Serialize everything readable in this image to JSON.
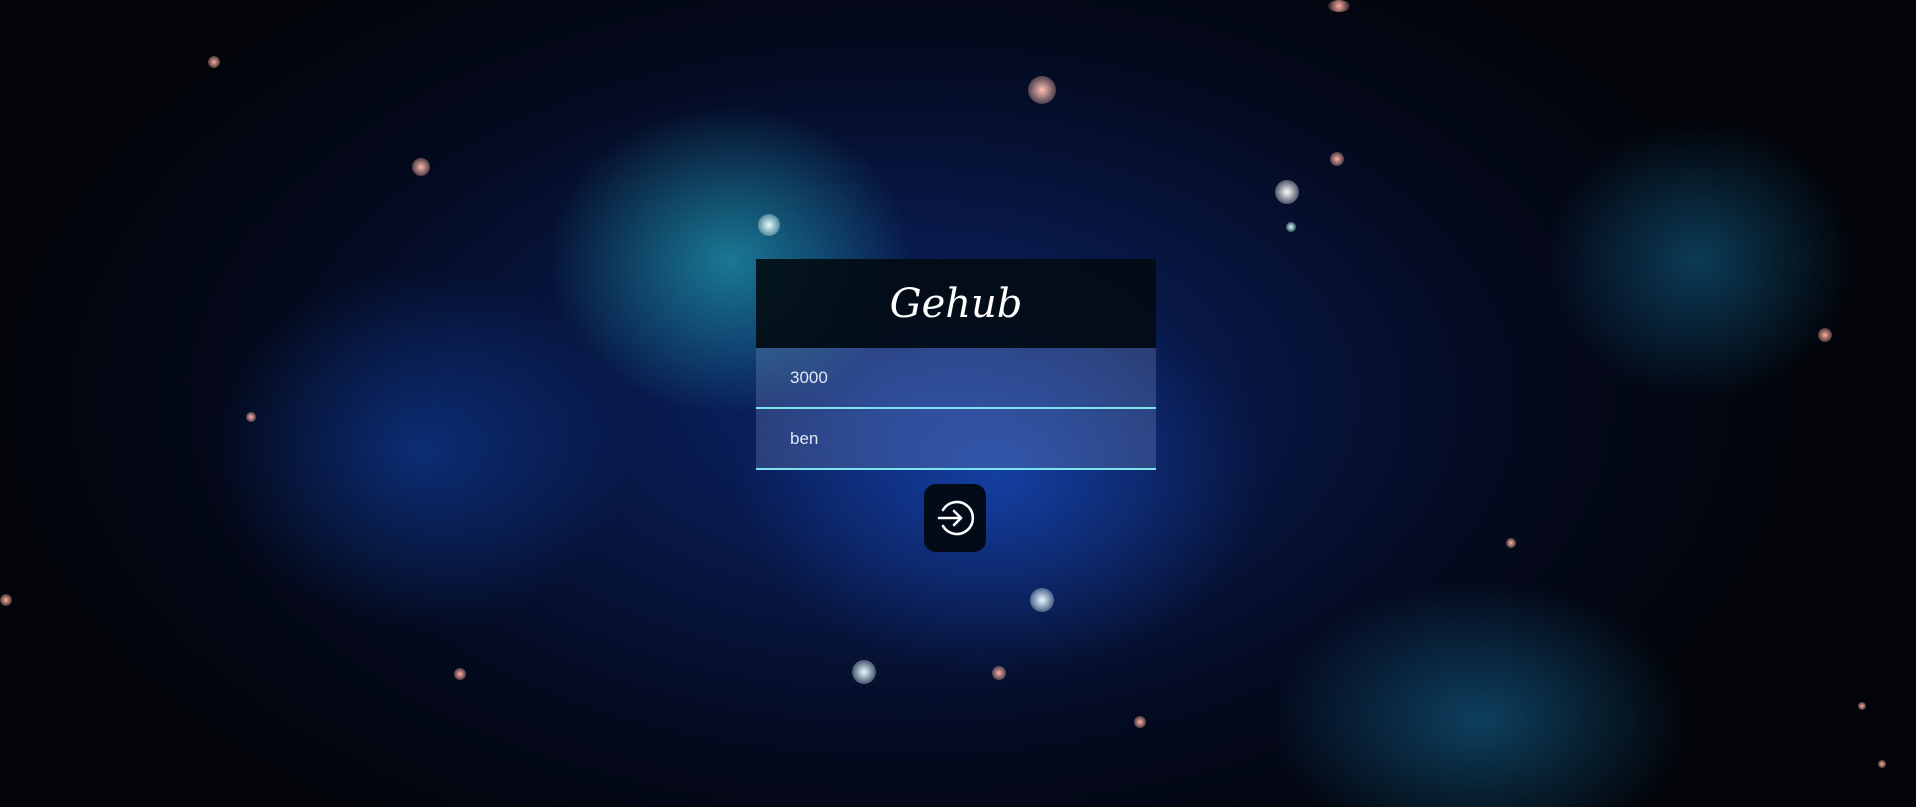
{
  "app": {
    "title": "Gehub"
  },
  "form": {
    "port_value": "3000",
    "username_value": "ben"
  },
  "icons": {
    "submit": "login-arrow-icon"
  },
  "colors": {
    "field_underline": "#7fe3ee",
    "title_bar": "#020a10"
  }
}
